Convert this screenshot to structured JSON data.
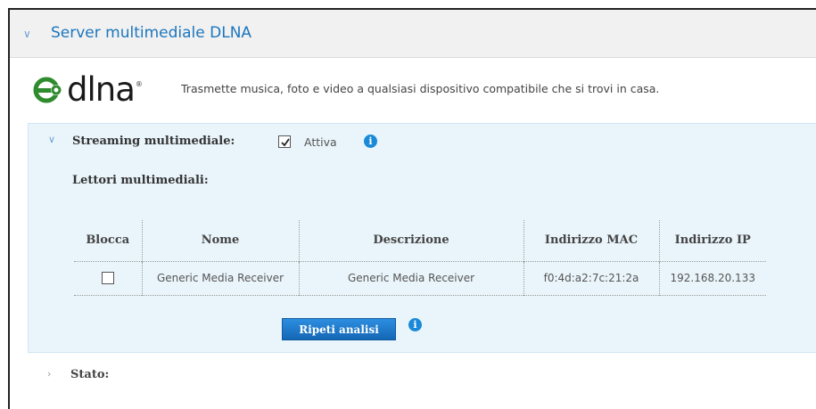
{
  "header": {
    "title": "Server multimediale DLNA",
    "chevron_icon": "chevron-down-icon"
  },
  "intro": {
    "logo_text": "dlna",
    "logo_mark": "®",
    "description": "Trasmette musica, foto e video a qualsiasi dispositivo compatibile che si trovi in casa."
  },
  "streaming": {
    "label": "Streaming multimediale:",
    "checkbox_checked": true,
    "checkbox_label": "Attiva",
    "info_glyph": "i"
  },
  "players": {
    "label": "Lettori multimediali:",
    "columns": [
      "Blocca",
      "Nome",
      "Descrizione",
      "Indirizzo MAC",
      "Indirizzo IP"
    ],
    "rows": [
      {
        "blocca": false,
        "nome": "Generic Media Receiver",
        "descrizione": "Generic Media Receiver",
        "mac": "f0:4d:a2:7c:21:2a",
        "ip": "192.168.20.133"
      }
    ],
    "rescan_button": "Ripeti analisi",
    "info_glyph": "i"
  },
  "stato": {
    "label": "Stato:"
  },
  "colors": {
    "accent": "#1b76bd",
    "panel_bg": "#eaf5fb",
    "button": "#1a7ad0",
    "info": "#1a8ad8"
  }
}
